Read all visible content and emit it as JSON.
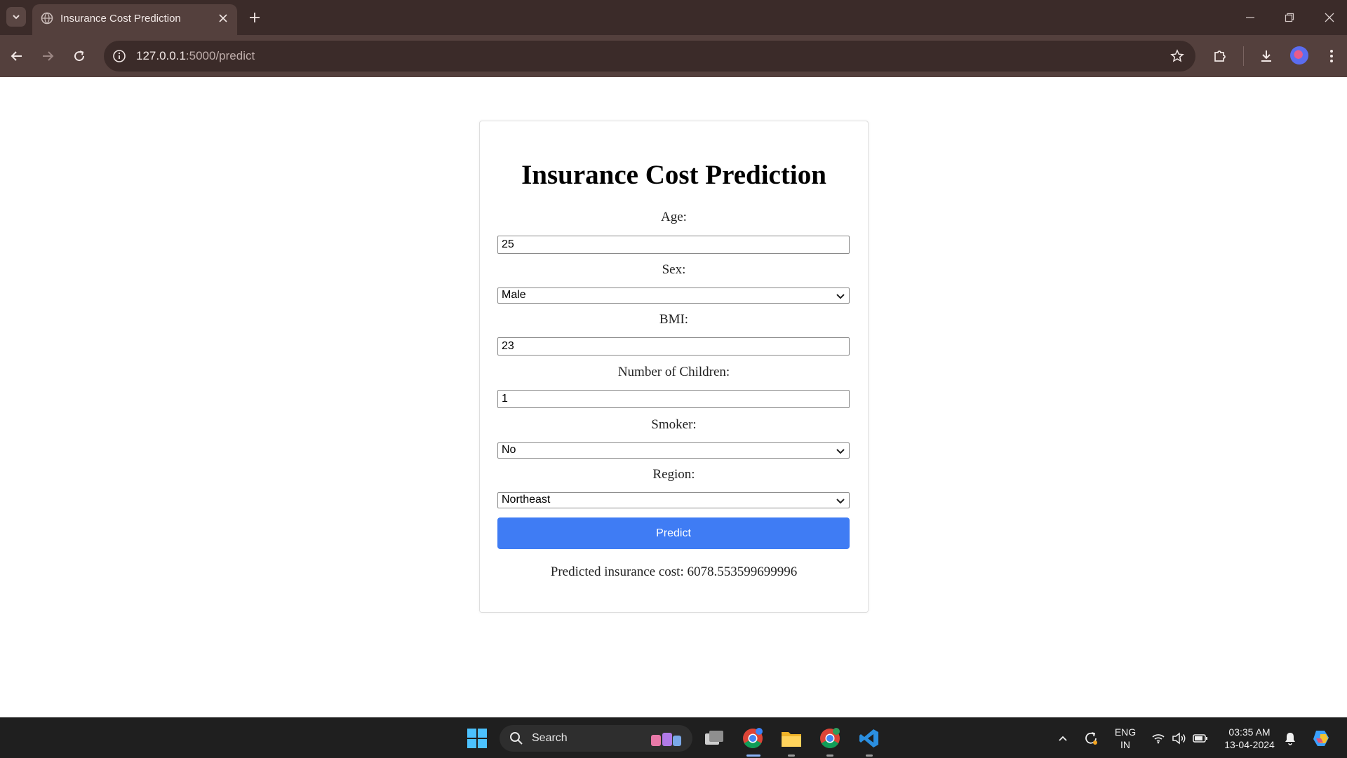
{
  "browser": {
    "tab_title": "Insurance Cost Prediction",
    "url_host": "127.0.0.1",
    "url_path": ":5000/predict"
  },
  "page": {
    "title": "Insurance Cost Prediction",
    "age_label": "Age:",
    "age_value": "25",
    "sex_label": "Sex:",
    "sex_value": "Male",
    "bmi_label": "BMI:",
    "bmi_value": "23",
    "children_label": "Number of Children:",
    "children_value": "1",
    "smoker_label": "Smoker:",
    "smoker_value": "No",
    "region_label": "Region:",
    "region_value": "Northeast",
    "predict_label": "Predict",
    "result_text": "Predicted insurance cost: 6078.553599699996"
  },
  "taskbar": {
    "search_text": "Search",
    "lang_line1": "ENG",
    "lang_line2": "IN",
    "time": "03:35 AM",
    "date": "13-04-2024"
  },
  "colors": {
    "chrome_dark": "#3b2b29",
    "chrome_toolbar": "#54403d",
    "predict_button": "#3f7cf4",
    "taskbar": "#1f1f1f"
  }
}
